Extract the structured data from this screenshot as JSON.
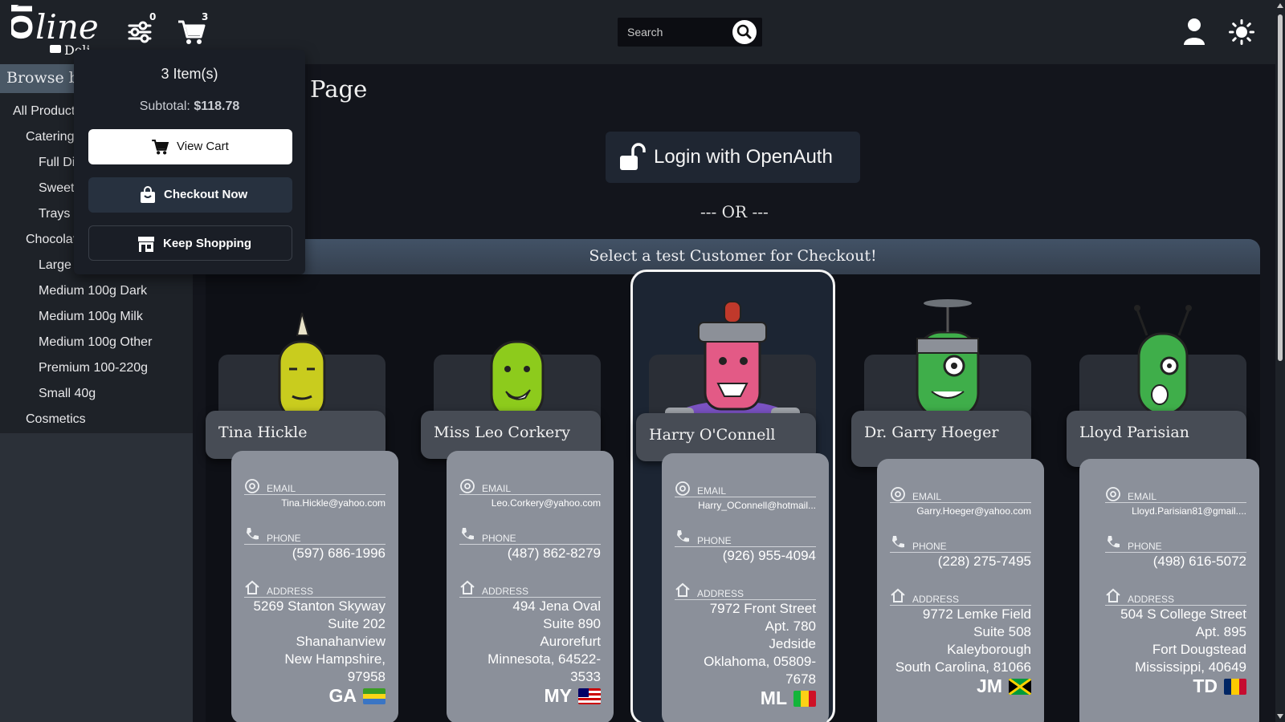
{
  "header": {
    "logo_text": "Online Deli",
    "filters_badge": "0",
    "cart_badge": "3",
    "search_placeholder": "Search"
  },
  "sidebar": {
    "title": "Browse by Category",
    "items": [
      {
        "label": "All Products"
      },
      {
        "label": "Catering"
      },
      {
        "label": "Full Dinners"
      },
      {
        "label": "Sweets"
      },
      {
        "label": "Trays"
      },
      {
        "label": "Chocolate"
      },
      {
        "label": "Large"
      },
      {
        "label": "Medium 100g Dark"
      },
      {
        "label": "Medium 100g Milk"
      },
      {
        "label": "Medium 100g Other"
      },
      {
        "label": "Premium 100-220g"
      },
      {
        "label": "Small 40g"
      },
      {
        "label": "Cosmetics"
      }
    ]
  },
  "main": {
    "page_title": "Page",
    "login_button": "Login with OpenAuth",
    "or_text": "--- OR ---",
    "select_header": "Select a test Customer for Checkout!"
  },
  "labels": {
    "email": "EMAIL",
    "phone": "PHONE",
    "address": "ADDRESS"
  },
  "customers": [
    {
      "name": "Tina Hickle",
      "email": "Tina.Hickle@yahoo.com",
      "phone": "(597) 686-1996",
      "address": [
        "5269 Stanton Skyway",
        "Suite 202",
        "Shanahanview",
        "New Hampshire,",
        "97958"
      ],
      "country": "GA",
      "selected": false
    },
    {
      "name": "Miss Leo Corkery",
      "email": "Leo.Corkery@yahoo.com",
      "phone": "(487) 862-8279",
      "address": [
        "494 Jena Oval",
        "Suite 890",
        "Aurorefurt",
        "Minnesota, 64522-",
        "3533"
      ],
      "country": "MY",
      "selected": false
    },
    {
      "name": "Harry O'Connell",
      "email": "Harry_OConnell@hotmail...",
      "phone": "(926) 955-4094",
      "address": [
        "7972 Front Street",
        "Apt. 780",
        "Jedside",
        "Oklahoma, 05809-",
        "7678"
      ],
      "country": "ML",
      "selected": true
    },
    {
      "name": "Dr. Garry Hoeger",
      "email": "Garry.Hoeger@yahoo.com",
      "phone": "(228) 275-7495",
      "address": [
        "9772 Lemke Field",
        "Suite 508",
        "Kaleyborough",
        "South Carolina, 81066"
      ],
      "country": "JM",
      "selected": false
    },
    {
      "name": "Lloyd Parisian",
      "email": "Lloyd.Parisian81@gmail....",
      "phone": "(498) 616-5072",
      "address": [
        "504 S College Street",
        "Apt. 895",
        "Fort Dougstead",
        "Mississippi, 40649"
      ],
      "country": "TD",
      "selected": false
    }
  ],
  "cart_popup": {
    "count": "3 Item(s)",
    "subtotal_label": "Subtotal:",
    "subtotal_value": "$118.78",
    "view_cart": "View Cart",
    "checkout_now": "Checkout Now",
    "keep_shopping": "Keep Shopping"
  },
  "colors": {
    "header_bg": "#1e2228",
    "accent_blue": "#1f2632",
    "card_info_bg": "#8b909a"
  }
}
